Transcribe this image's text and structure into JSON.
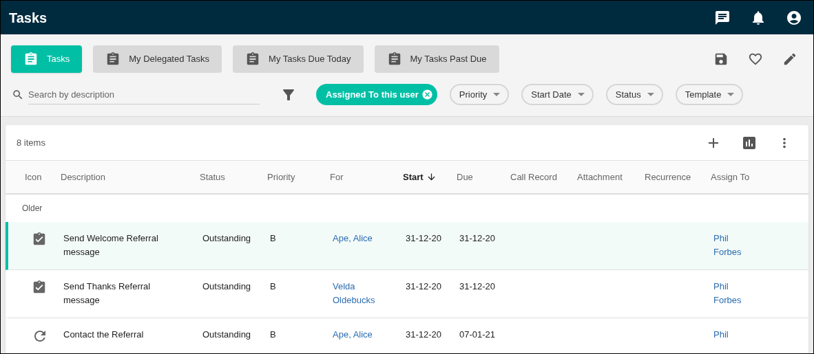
{
  "app_bar": {
    "title": "Tasks"
  },
  "views": [
    {
      "label": "Tasks",
      "selected": true
    },
    {
      "label": "My Delegated Tasks",
      "selected": false
    },
    {
      "label": "My Tasks Due Today",
      "selected": false
    },
    {
      "label": "My Tasks Past Due",
      "selected": false
    }
  ],
  "search": {
    "placeholder": "Search by description"
  },
  "filters": [
    {
      "label": "Assigned To this user",
      "active": true
    },
    {
      "label": "Priority",
      "active": false
    },
    {
      "label": "Start Date",
      "active": false
    },
    {
      "label": "Status",
      "active": false
    },
    {
      "label": "Template",
      "active": false
    }
  ],
  "table": {
    "count": "8 items",
    "columns": [
      {
        "label": "Icon",
        "sorted": false
      },
      {
        "label": "Description",
        "sorted": false
      },
      {
        "label": "Status",
        "sorted": false
      },
      {
        "label": "Priority",
        "sorted": false
      },
      {
        "label": "For",
        "sorted": false
      },
      {
        "label": "Start",
        "sorted": true
      },
      {
        "label": "Due",
        "sorted": false
      },
      {
        "label": "Call Record",
        "sorted": false
      },
      {
        "label": "Attachment",
        "sorted": false
      },
      {
        "label": "Recurrence",
        "sorted": false
      },
      {
        "label": "Assign To",
        "sorted": false
      }
    ],
    "group": "Older",
    "rows": [
      {
        "kind": "done",
        "selected": true,
        "description": "Send Welcome Referral message",
        "status": "Outstanding",
        "priority": "B",
        "for": "Ape, Alice",
        "start": "31-12-20",
        "due": "31-12-20",
        "assign_to": "Phil Forbes"
      },
      {
        "kind": "done",
        "selected": false,
        "description": "Send Thanks Referral message",
        "status": "Outstanding",
        "priority": "B",
        "for": "Velda Oldebucks",
        "start": "31-12-20",
        "due": "31-12-20",
        "assign_to": "Phil Forbes"
      },
      {
        "kind": "recurring",
        "selected": false,
        "description": "Contact the Referral",
        "status": "Outstanding",
        "priority": "B",
        "for": "Ape, Alice",
        "start": "31-12-20",
        "due": "07-01-21",
        "assign_to": "Phil"
      }
    ]
  }
}
